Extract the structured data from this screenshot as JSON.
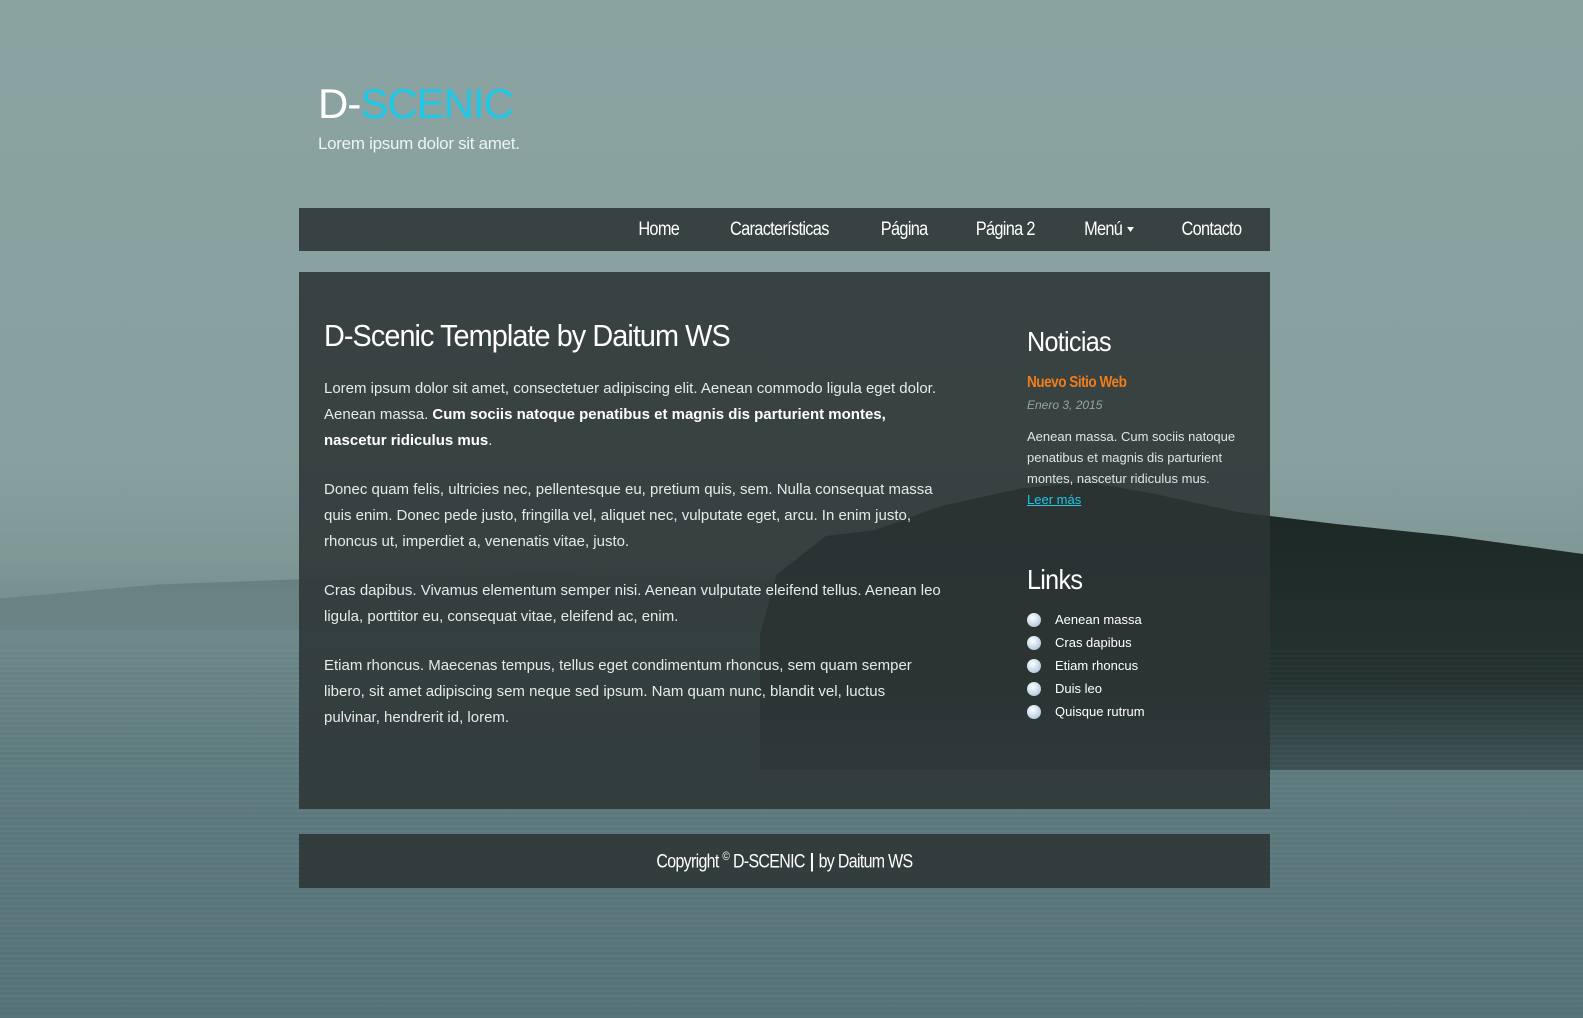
{
  "site": {
    "logo_prefix": "D-",
    "logo_accent": "SCENIC",
    "tagline": "Lorem ipsum dolor sit amet."
  },
  "nav": {
    "items": [
      {
        "label": "Home"
      },
      {
        "label": "Características"
      },
      {
        "label": "Página"
      },
      {
        "label": "Página 2"
      },
      {
        "label": "Menú"
      },
      {
        "label": "Contacto"
      }
    ]
  },
  "main": {
    "title": "D-Scenic Template by Daitum WS",
    "p1_text": "Lorem ipsum dolor sit amet, consectetuer adipiscing elit. Aenean commodo ligula eget dolor. Aenean massa. ",
    "p1_bold": "Cum sociis natoque penatibus et magnis dis parturient montes, nascetur ridiculus mus",
    "p1_end": ".",
    "p2": "Donec quam felis, ultricies nec, pellentesque eu, pretium quis, sem. Nulla consequat massa quis enim. Donec pede justo, fringilla vel, aliquet nec, vulputate eget, arcu. In enim justo, rhoncus ut, imperdiet a, venenatis vitae, justo.",
    "p3": "Cras dapibus. Vivamus elementum semper nisi. Aenean vulputate eleifend tellus. Aenean leo ligula, porttitor eu, consequat vitae, eleifend ac, enim.",
    "p4": "Etiam rhoncus. Maecenas tempus, tellus eget condimentum rhoncus, sem quam semper libero, sit amet adipiscing sem neque sed ipsum. Nam quam nunc, blandit vel, luctus pulvinar, hendrerit id, lorem."
  },
  "sidebar": {
    "news_heading": "Noticias",
    "news_item_title": "Nuevo Sitio Web",
    "news_item_date": "Enero 3, 2015",
    "news_item_body": "Aenean massa. Cum sociis natoque penatibus et magnis dis parturient montes, nascetur ridiculus mus.",
    "read_more": "Leer más",
    "links_heading": "Links",
    "links": [
      {
        "label": "Aenean massa"
      },
      {
        "label": "Cras dapibus"
      },
      {
        "label": "Etiam rhoncus"
      },
      {
        "label": "Duis leo"
      },
      {
        "label": "Quisque rutrum"
      }
    ]
  },
  "footer": {
    "copyright": "Copyright",
    "symbol": "©",
    "brand": "D-SCENIC",
    "separator": "|",
    "by": "by Daitum WS"
  },
  "colors": {
    "accent": "#1ec8e6",
    "news_title": "#f07c1a",
    "panel": "#2c3434"
  }
}
